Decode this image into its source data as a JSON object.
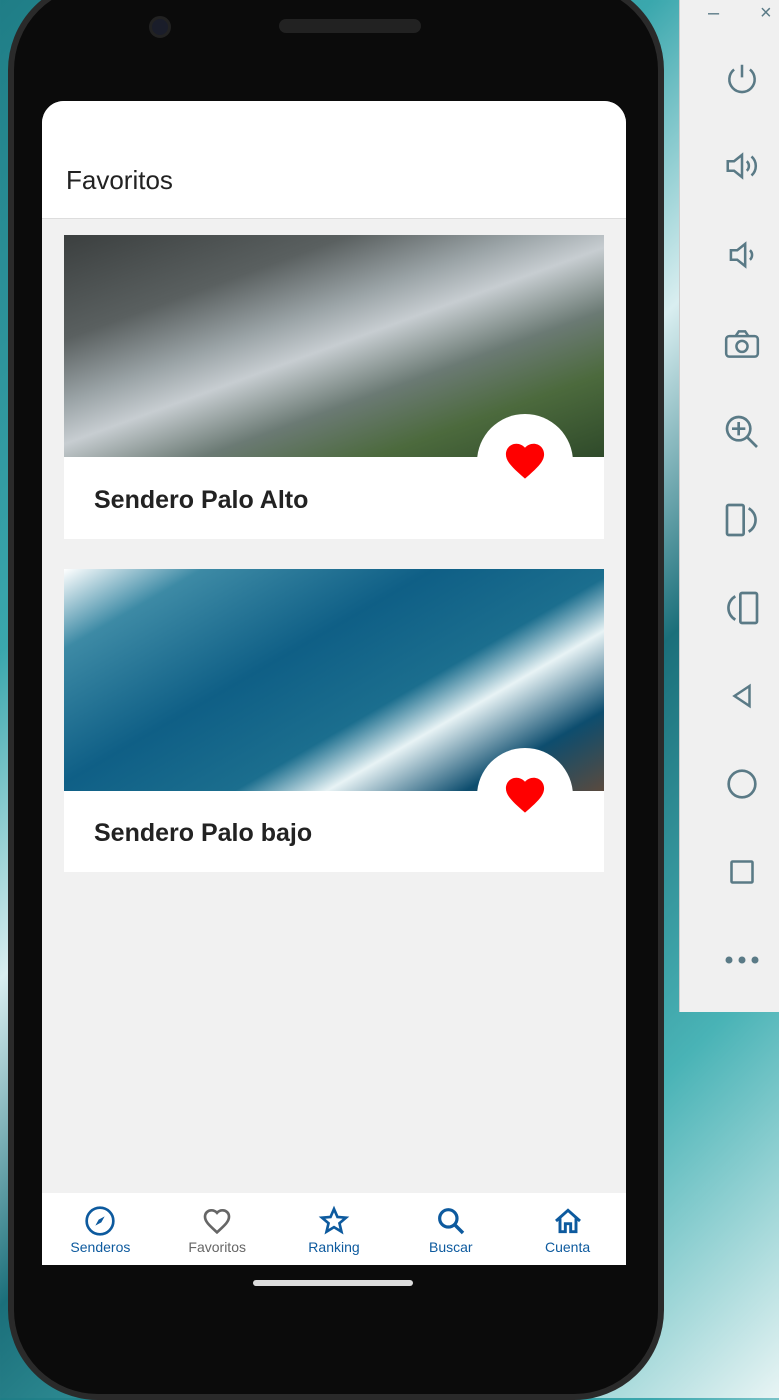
{
  "app": {
    "title": "Favoritos"
  },
  "cards": [
    {
      "title": "Sendero Palo Alto",
      "favorite": true
    },
    {
      "title": "Sendero Palo bajo",
      "favorite": true
    }
  ],
  "nav": [
    {
      "label": "Senderos",
      "icon": "compass-icon"
    },
    {
      "label": "Favoritos",
      "icon": "heart-outline-icon",
      "active": true
    },
    {
      "label": "Ranking",
      "icon": "star-icon"
    },
    {
      "label": "Buscar",
      "icon": "search-icon"
    },
    {
      "label": "Cuenta",
      "icon": "home-icon"
    }
  ],
  "emulator": {
    "minimize": "–",
    "close": "×",
    "tools": [
      "power",
      "volume-up",
      "volume-down",
      "camera",
      "zoom",
      "rotate-left",
      "rotate-right",
      "back",
      "home",
      "overview",
      "more"
    ]
  },
  "colors": {
    "accent": "#0d5a9e",
    "heart": "#ff0000",
    "inactive": "#666666"
  }
}
